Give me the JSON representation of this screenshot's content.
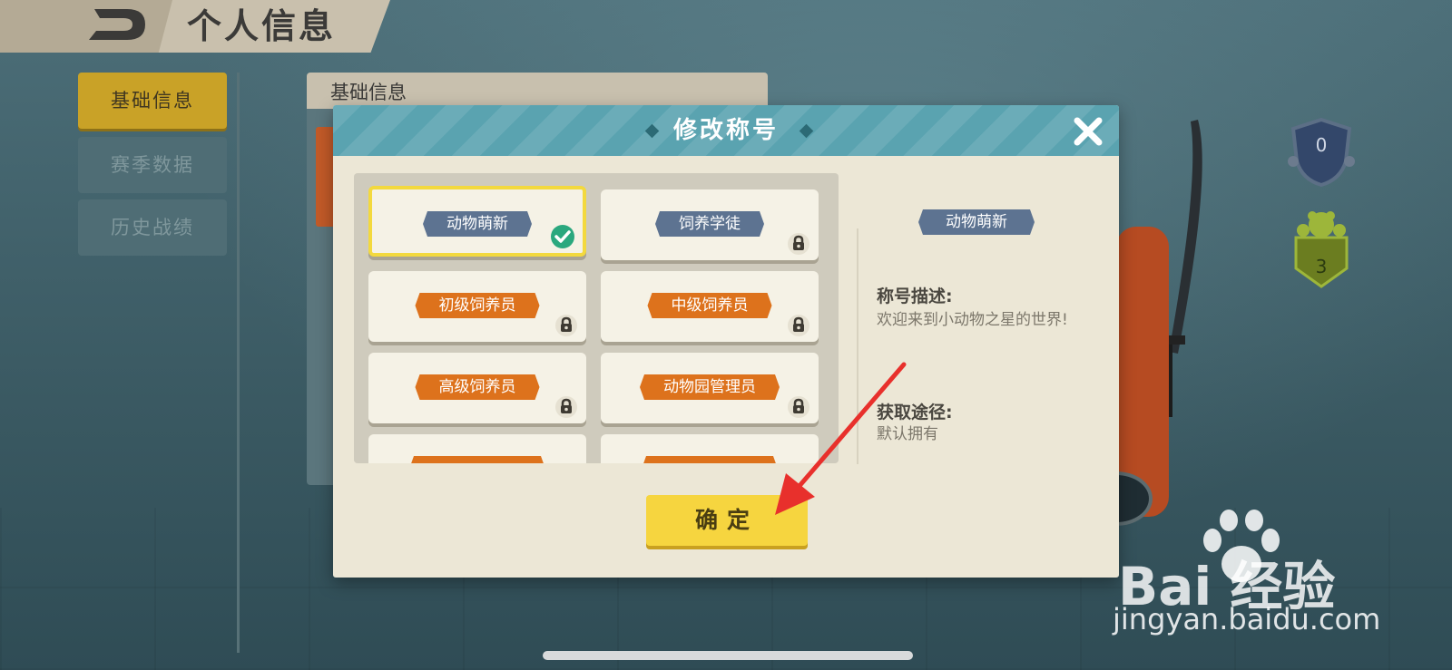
{
  "header": {
    "title": "个人信息"
  },
  "sidebar": {
    "items": [
      {
        "label": "基础信息",
        "active": true
      },
      {
        "label": "赛季数据",
        "active": false
      },
      {
        "label": "历史战绩",
        "active": false
      }
    ]
  },
  "background_panel": {
    "title": "基础信息"
  },
  "badges": {
    "shield_count": "0",
    "paw_count": "3"
  },
  "modal": {
    "title": "修改称号",
    "titles": [
      {
        "label": "动物萌新",
        "color": "blue",
        "selected": true,
        "locked": false
      },
      {
        "label": "饲养学徒",
        "color": "blue",
        "selected": false,
        "locked": true
      },
      {
        "label": "初级饲养员",
        "color": "orange",
        "selected": false,
        "locked": true
      },
      {
        "label": "中级饲养员",
        "color": "orange",
        "selected": false,
        "locked": true
      },
      {
        "label": "高级饲养员",
        "color": "orange",
        "selected": false,
        "locked": true
      },
      {
        "label": "动物园管理员",
        "color": "orange",
        "selected": false,
        "locked": true
      }
    ],
    "detail": {
      "selected_title": "动物萌新",
      "description_label": "称号描述:",
      "description": "欢迎来到小动物之星的世界!",
      "source_label": "获取途径:",
      "source": "默认拥有"
    },
    "confirm_label": "确定"
  },
  "watermark": {
    "brand": "Bai  经验",
    "url": "jingyan.baidu.com"
  },
  "colors": {
    "accent_yellow": "#f6d53f",
    "header_teal": "#5aa3b0",
    "tag_blue": "#5d7391",
    "tag_orange": "#dd721c",
    "annotation_red": "#e8302c"
  }
}
